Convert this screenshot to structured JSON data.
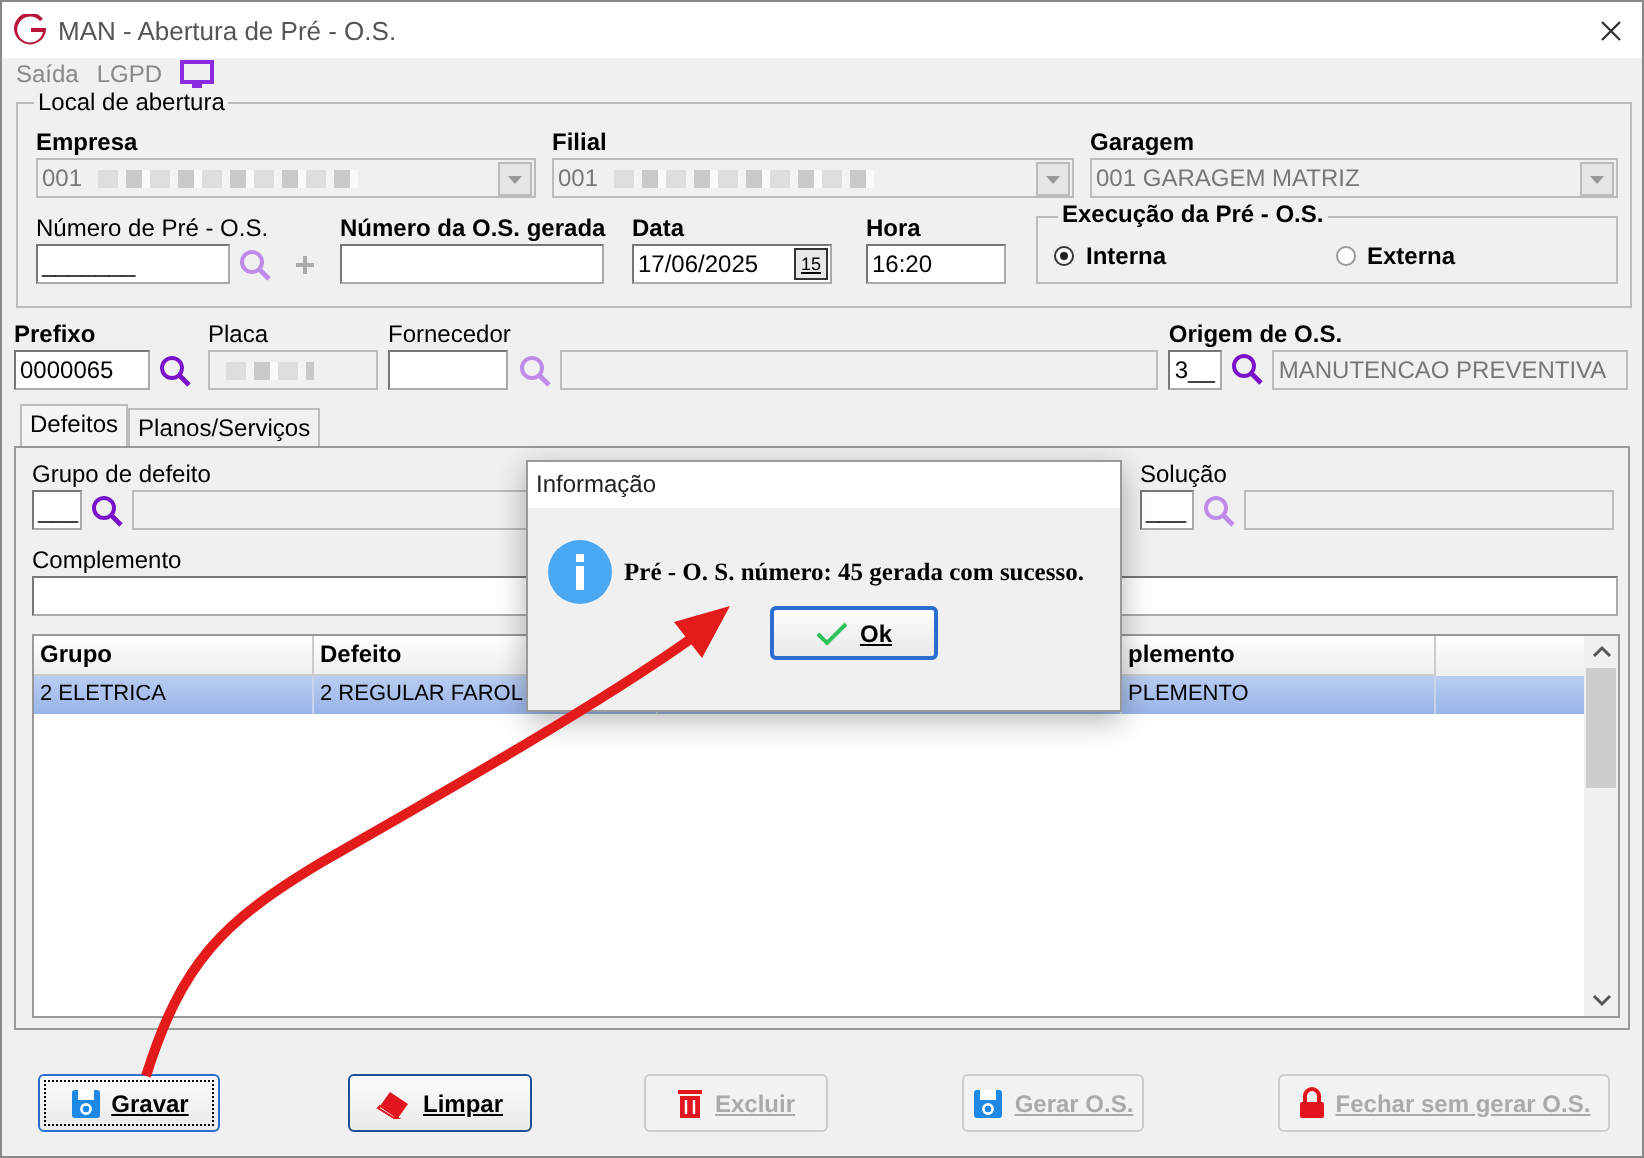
{
  "window": {
    "title": "MAN - Abertura de Pré - O.S."
  },
  "menu": [
    {
      "label": "Saída"
    },
    {
      "label": "LGPD"
    }
  ],
  "local": {
    "title": "Local de abertura",
    "empresa": {
      "label": "Empresa",
      "value": "001"
    },
    "filial": {
      "label": "Filial",
      "value": "001"
    },
    "garagem": {
      "label": "Garagem",
      "value": "001 GARAGEM MATRIZ"
    },
    "numero_pre": {
      "label": "Número de Pré - O.S.",
      "value": "_______"
    },
    "numero_os": {
      "label": "Número da O.S. gerada"
    },
    "data": {
      "label": "Data",
      "value": "17/06/2025",
      "calendar": "15"
    },
    "hora": {
      "label": "Hora",
      "value": "16:20"
    },
    "execucao": {
      "title": "Execução da Pré - O.S.",
      "options": [
        {
          "label": "Interna",
          "selected": true
        },
        {
          "label": "Externa",
          "selected": false
        }
      ]
    }
  },
  "vehicle": {
    "prefixo": {
      "label": "Prefixo",
      "value": "0000065"
    },
    "placa": {
      "label": "Placa"
    },
    "fornecedor": {
      "label": "Fornecedor"
    },
    "origem": {
      "label": "Origem de O.S.",
      "code": "3__",
      "description": "MANUTENCAO PREVENTIVA"
    }
  },
  "tabs": [
    {
      "label": "Defeitos",
      "selected": true
    },
    {
      "label": "Planos/Serviços",
      "selected": false
    }
  ],
  "defeitos": {
    "grupo": {
      "label": "Grupo de defeito",
      "code": "___"
    },
    "solucao": {
      "label": "Solução",
      "code": "___"
    },
    "complemento": {
      "label": "Complemento"
    },
    "table": {
      "columns": [
        {
          "label": "Grupo"
        },
        {
          "label": "Defeito"
        },
        {},
        {
          "label": "plemento"
        }
      ],
      "rows": [
        {
          "cells": [
            "2 ELETRICA",
            "2 REGULAR FAROL",
            null,
            "PLEMENTO"
          ],
          "selected": true
        }
      ]
    }
  },
  "dialog": {
    "title": "Informação",
    "message": "Pré - O. S. número: 45 gerada com sucesso.",
    "button": "Ok"
  },
  "buttons": [
    {
      "label": "Gravar",
      "kind": "floppy",
      "disabled": false,
      "focused": true
    },
    {
      "label": "Limpar",
      "kind": "eraser",
      "disabled": false,
      "focused": false
    },
    {
      "label": "Excluir",
      "kind": "trash",
      "disabled": true,
      "focused": false
    },
    {
      "label": "Gerar O.S.",
      "kind": "floppy",
      "disabled": true,
      "focused": false
    },
    {
      "label": "Fechar sem gerar O.S.",
      "kind": "lock",
      "disabled": true,
      "focused": false
    }
  ]
}
